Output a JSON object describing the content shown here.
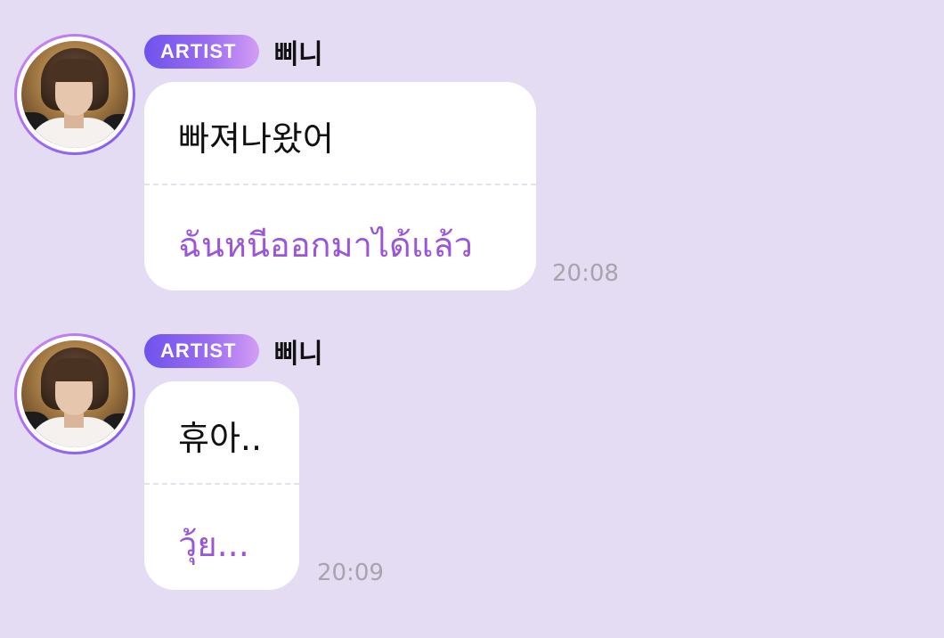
{
  "colors": {
    "background": "#e4dcf2",
    "bubble": "#ffffff",
    "translation_text": "#9a55d8",
    "timestamp": "#a8a3ad",
    "badge_gradient_start": "#6f52ee",
    "badge_gradient_end": "#d49df5"
  },
  "messages": [
    {
      "badge": "ARTIST",
      "sender": "삐니",
      "text": "빠져나왔어",
      "translation": "ฉันหนีออกมาได้แล้ว",
      "time": "20:08"
    },
    {
      "badge": "ARTIST",
      "sender": "삐니",
      "text": "휴아..",
      "translation": "วุ้ย...",
      "time": "20:09"
    }
  ]
}
